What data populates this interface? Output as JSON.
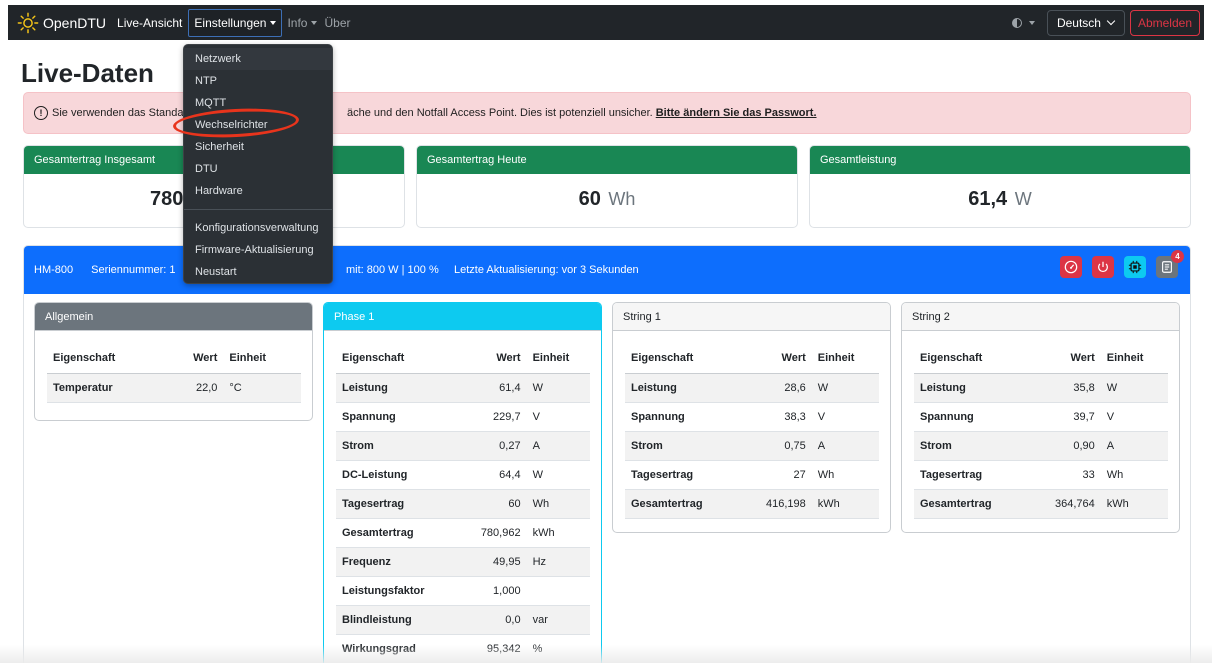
{
  "navbar": {
    "brand": "OpenDTU",
    "items": [
      {
        "label": "Live-Ansicht"
      },
      {
        "label": "Einstellungen"
      },
      {
        "label": "Info"
      },
      {
        "label": "Über"
      }
    ],
    "language": "Deutsch",
    "logout": "Abmelden"
  },
  "page": {
    "title": "Live-Daten"
  },
  "alert": {
    "text_a": "Sie verwenden das Standa",
    "text_b": "äche und den Notfall Access Point. Dies ist potenziell unsicher.",
    "link": "Bitte ändern Sie das Passwort."
  },
  "summary": [
    {
      "title": "Gesamtertrag Insgesamt",
      "value": "780",
      "unit": ""
    },
    {
      "title": "Gesamtertrag Heute",
      "value": "60",
      "unit": "Wh"
    },
    {
      "title": "Gesamtleistung",
      "value": "61,4",
      "unit": "W"
    }
  ],
  "inverter": {
    "model": "HM-800",
    "serial": "Seriennummer: 1",
    "limit": "mit: 800 W | 100 %",
    "update": "Letzte Aktualisierung: vor 3 Sekunden",
    "event_count": "4",
    "colors": {
      "header": "#0d6efd",
      "danger": "#dc3545",
      "info": "#0dcaf0",
      "secondary": "#6c757d"
    }
  },
  "panels": {
    "general": {
      "title": "Allgemein",
      "headers": [
        "Eigenschaft",
        "Wert",
        "Einheit"
      ],
      "rows": [
        [
          "Temperatur",
          "22,0",
          "°C"
        ]
      ]
    },
    "phase1": {
      "title": "Phase 1",
      "headers": [
        "Eigenschaft",
        "Wert",
        "Einheit"
      ],
      "rows": [
        [
          "Leistung",
          "61,4",
          "W"
        ],
        [
          "Spannung",
          "229,7",
          "V"
        ],
        [
          "Strom",
          "0,27",
          "A"
        ],
        [
          "DC-Leistung",
          "64,4",
          "W"
        ],
        [
          "Tagesertrag",
          "60",
          "Wh"
        ],
        [
          "Gesamtertrag",
          "780,962",
          "kWh"
        ],
        [
          "Frequenz",
          "49,95",
          "Hz"
        ],
        [
          "Leistungsfaktor",
          "1,000",
          ""
        ],
        [
          "Blindleistung",
          "0,0",
          "var"
        ],
        [
          "Wirkungsgrad",
          "95,342",
          "%"
        ]
      ]
    },
    "string1": {
      "title": "String 1",
      "headers": [
        "Eigenschaft",
        "Wert",
        "Einheit"
      ],
      "rows": [
        [
          "Leistung",
          "28,6",
          "W"
        ],
        [
          "Spannung",
          "38,3",
          "V"
        ],
        [
          "Strom",
          "0,75",
          "A"
        ],
        [
          "Tagesertrag",
          "27",
          "Wh"
        ],
        [
          "Gesamtertrag",
          "416,198",
          "kWh"
        ]
      ]
    },
    "string2": {
      "title": "String 2",
      "headers": [
        "Eigenschaft",
        "Wert",
        "Einheit"
      ],
      "rows": [
        [
          "Leistung",
          "35,8",
          "W"
        ],
        [
          "Spannung",
          "39,7",
          "V"
        ],
        [
          "Strom",
          "0,90",
          "A"
        ],
        [
          "Tagesertrag",
          "33",
          "Wh"
        ],
        [
          "Gesamtertrag",
          "364,764",
          "kWh"
        ]
      ]
    }
  },
  "dropdown": {
    "items": [
      "Netzwerk",
      "NTP",
      "MQTT",
      "Wechselrichter",
      "Sicherheit",
      "DTU",
      "Hardware"
    ],
    "items2": [
      "Konfigurationsverwaltung",
      "Firmware-Aktualisierung",
      "Neustart"
    ],
    "highlighted": "Wechselrichter"
  }
}
